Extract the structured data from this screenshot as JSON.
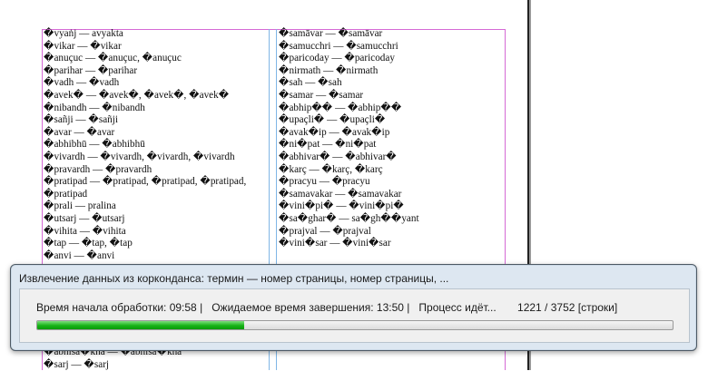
{
  "document": {
    "left_column": [
      "�vyaṅj — avyakta",
      "�vikar — �vikar",
      "�anuçuc — �anuçuc, �anuçuc",
      "�parihar — �parihar",
      "�vadh — �vadh",
      "�avek� — �avek�, �avek�, �avek�",
      "�nibandh — �nibandh",
      "�sañji — �sañji",
      "�avar — �avar",
      "�abhibhū — �abhibhū",
      "�vivardh — �vivardh, �vivardh, �vivardh",
      "�pravardh — �pravardh",
      "�pratipad — �pratipad, �pratipad, �pratipad,",
      "�pratipad",
      "�prali — pralina",
      "�utsarj — �utsarj",
      "�vihita — �vihita",
      "�tap — �tap, �tap",
      "�anvi — �anvi"
    ],
    "right_column": [
      "�samāvar — �samāvar",
      "�samucchri — �samucchri",
      "�paricoday — �paricoday",
      "�nirmath — �nirmath",
      "�sah — �sah",
      "�samar — �samar",
      "�abhip�� — �abhip��",
      "�upaçli� — �upaçli�",
      "�avak�ip — �avak�ip",
      "�ni�pat — �ni�pat",
      "�abhivar� — �abhivar�",
      "�karç — �karç, �karç",
      "�pracyu — �pracyu",
      "�samavakar — �samavakar",
      "�vini�pi� — �vini�pi�",
      "�sa�ghar� — sa�gh��yant",
      "�prajval — �prajval",
      "�vini�sar — �vini�sar"
    ],
    "bottom_lines": [
      "�abhisa�kha — �abhisa�kha",
      "�sarj — �sarj"
    ]
  },
  "dialog": {
    "title": "Извлечение данных из корконданса: термин — номер страницы, номер страницы, ...",
    "start_time": "Время начала обработки: 09:58 |",
    "eta": "Ожидаемое время завершения: 13:50 |",
    "status": "Процесс идёт...",
    "count": "1221 / 3752 [строки]",
    "progress_fraction": 0.325,
    "progress_color": "#17b317"
  }
}
